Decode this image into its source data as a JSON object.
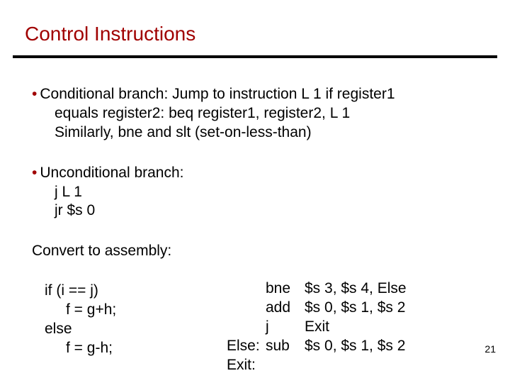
{
  "colors": {
    "accent": "#a00000",
    "text": "#000000",
    "rule": "#000000"
  },
  "title": "Control Instructions",
  "bullet_glyph": "•",
  "block1": {
    "line1_a": "Conditional branch: Jump to instruction L 1 if register1",
    "line2": "equals register2:       beq    register1,  register2,  L 1",
    "line3": "Similarly,  bne  and  slt (set-on-less-than)"
  },
  "block2": {
    "line1": "Unconditional branch:",
    "line2": "j     L 1",
    "line3": "jr    $s 0"
  },
  "block3": {
    "line1": "Convert to assembly:",
    "line2": "if  (i == j)",
    "line3": "f = g+h;",
    "line4": "else",
    "line5": "f = g-h;"
  },
  "asm": {
    "rows": [
      {
        "label": "",
        "op": "bne",
        "args": "$s 3, $s 4, Else"
      },
      {
        "label": "",
        "op": "add",
        "args": "$s 0, $s 1, $s 2"
      },
      {
        "label": "",
        "op": "j",
        "args": "Exit"
      },
      {
        "label": "Else:",
        "op": "sub",
        "args": "$s 0, $s 1, $s 2"
      },
      {
        "label": "Exit:",
        "op": "",
        "args": ""
      }
    ]
  },
  "page_number": "21"
}
